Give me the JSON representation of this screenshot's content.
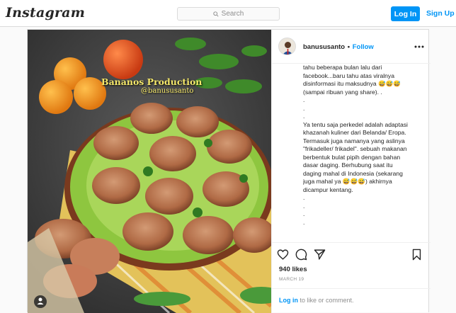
{
  "header": {
    "logo": "Instagram",
    "search_placeholder": "Search",
    "login_label": "Log In",
    "signup_label": "Sign Up"
  },
  "post": {
    "username": "banususanto",
    "separator": "•",
    "follow_label": "Follow",
    "watermark_title": "Bananos Production",
    "watermark_handle": "@banususanto",
    "caption_lines": [
      "tahu beberapa bulan lalu dari",
      "facebook...baru tahu atas viralnya",
      "disinformasi itu maksudnya 😅😅😅",
      "(sampai ribuan yang share). .",
      ".",
      ".",
      ".",
      "Ya tentu saja perkedel adalah adaptasi",
      "khazanah kuliner dari Belanda/ Eropa.",
      "Termasuk juga namanya yang aslinya",
      "\"frikadeller/ frikadel\". sebuah makanan",
      "berbentuk bulat pipih dengan bahan",
      "dasar daging. Berhubung saat itu",
      "daging mahal di Indonesia (sekarang",
      "juga mahal ya 😅😅😅) akhirnya",
      "dicampur kentang.",
      ".",
      ".",
      ".",
      "."
    ],
    "likes": "940 likes",
    "date": "MARCH 19",
    "comment_login": "Log in",
    "comment_rest": " to like or comment."
  },
  "colors": {
    "accent": "#0095f6",
    "text": "#262626",
    "muted": "#8e8e8e",
    "border": "#dbdbdb"
  },
  "icons": [
    "search-icon",
    "more-options-icon",
    "heart-icon",
    "comment-icon",
    "share-icon",
    "bookmark-icon",
    "user-icon"
  ]
}
